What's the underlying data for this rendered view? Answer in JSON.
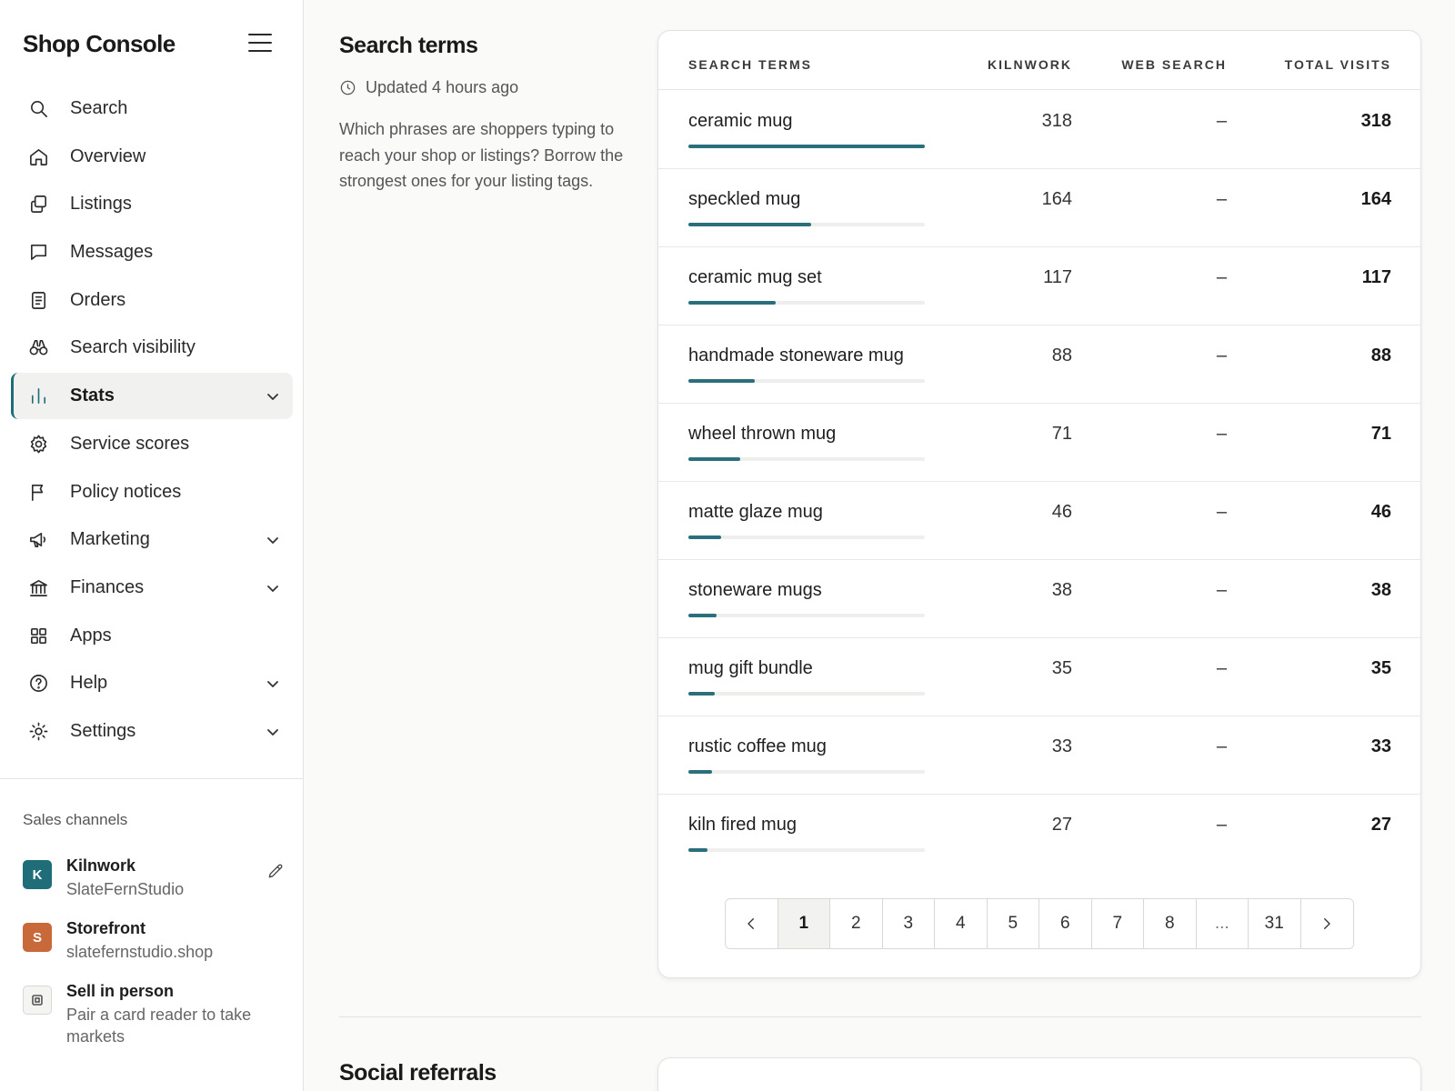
{
  "app": {
    "brand": "Shop Console"
  },
  "sidebar": {
    "items": [
      {
        "label": "Search",
        "icon": "search-icon",
        "expandable": false
      },
      {
        "label": "Overview",
        "icon": "home-icon",
        "expandable": false
      },
      {
        "label": "Listings",
        "icon": "listings-icon",
        "expandable": false
      },
      {
        "label": "Messages",
        "icon": "message-icon",
        "expandable": false
      },
      {
        "label": "Orders",
        "icon": "orders-icon",
        "expandable": false
      },
      {
        "label": "Search visibility",
        "icon": "binoculars-icon",
        "expandable": false
      },
      {
        "label": "Stats",
        "icon": "bar-chart-icon",
        "expandable": true,
        "active": true
      },
      {
        "label": "Service scores",
        "icon": "gear-icon",
        "expandable": false
      },
      {
        "label": "Policy notices",
        "icon": "flag-icon",
        "expandable": false
      },
      {
        "label": "Marketing",
        "icon": "megaphone-icon",
        "expandable": true
      },
      {
        "label": "Finances",
        "icon": "bank-icon",
        "expandable": true
      },
      {
        "label": "Apps",
        "icon": "apps-grid-icon",
        "expandable": false
      },
      {
        "label": "Help",
        "icon": "help-icon",
        "expandable": true
      },
      {
        "label": "Settings",
        "icon": "sun-settings-icon",
        "expandable": true
      }
    ],
    "sales_channels": {
      "title": "Sales channels",
      "channels": [
        {
          "badge": "K",
          "name": "Kilnwork",
          "sub": "SlateFernStudio",
          "color": "#1f6d78"
        },
        {
          "badge": "S",
          "name": "Storefront",
          "sub": "slatefernstudio.shop",
          "color": "#c8693a"
        },
        {
          "badge": "",
          "name": "Sell in person",
          "sub": "Pair a card reader to take markets"
        }
      ]
    }
  },
  "main": {
    "title": "Search terms",
    "updated": "Updated 4 hours ago",
    "description": "Which phrases are shoppers typing to reach your shop or listings? Borrow the strongest ones for your listing tags.",
    "table": {
      "headers": [
        "SEARCH TERMS",
        "KILNWORK",
        "WEB SEARCH",
        "TOTAL VISITS"
      ],
      "rows": [
        {
          "term": "ceramic mug",
          "kilnwork": "318",
          "web": "–",
          "total": "318",
          "share": 1.0
        },
        {
          "term": "speckled mug",
          "kilnwork": "164",
          "web": "–",
          "total": "164",
          "share": 0.52
        },
        {
          "term": "ceramic mug set",
          "kilnwork": "117",
          "web": "–",
          "total": "117",
          "share": 0.37
        },
        {
          "term": "handmade stoneware mug",
          "kilnwork": "88",
          "web": "–",
          "total": "88",
          "share": 0.28
        },
        {
          "term": "wheel thrown mug",
          "kilnwork": "71",
          "web": "–",
          "total": "71",
          "share": 0.22
        },
        {
          "term": "matte glaze mug",
          "kilnwork": "46",
          "web": "–",
          "total": "46",
          "share": 0.14
        },
        {
          "term": "stoneware mugs",
          "kilnwork": "38",
          "web": "–",
          "total": "38",
          "share": 0.12
        },
        {
          "term": "mug gift bundle",
          "kilnwork": "35",
          "web": "–",
          "total": "35",
          "share": 0.11
        },
        {
          "term": "rustic coffee mug",
          "kilnwork": "33",
          "web": "–",
          "total": "33",
          "share": 0.1
        },
        {
          "term": "kiln fired mug",
          "kilnwork": "27",
          "web": "–",
          "total": "27",
          "share": 0.08
        }
      ]
    },
    "pagination": {
      "pages": [
        "1",
        "2",
        "3",
        "4",
        "5",
        "6",
        "7",
        "8",
        "...",
        "31"
      ],
      "current": "1"
    },
    "next_section_title": "Social referrals"
  }
}
